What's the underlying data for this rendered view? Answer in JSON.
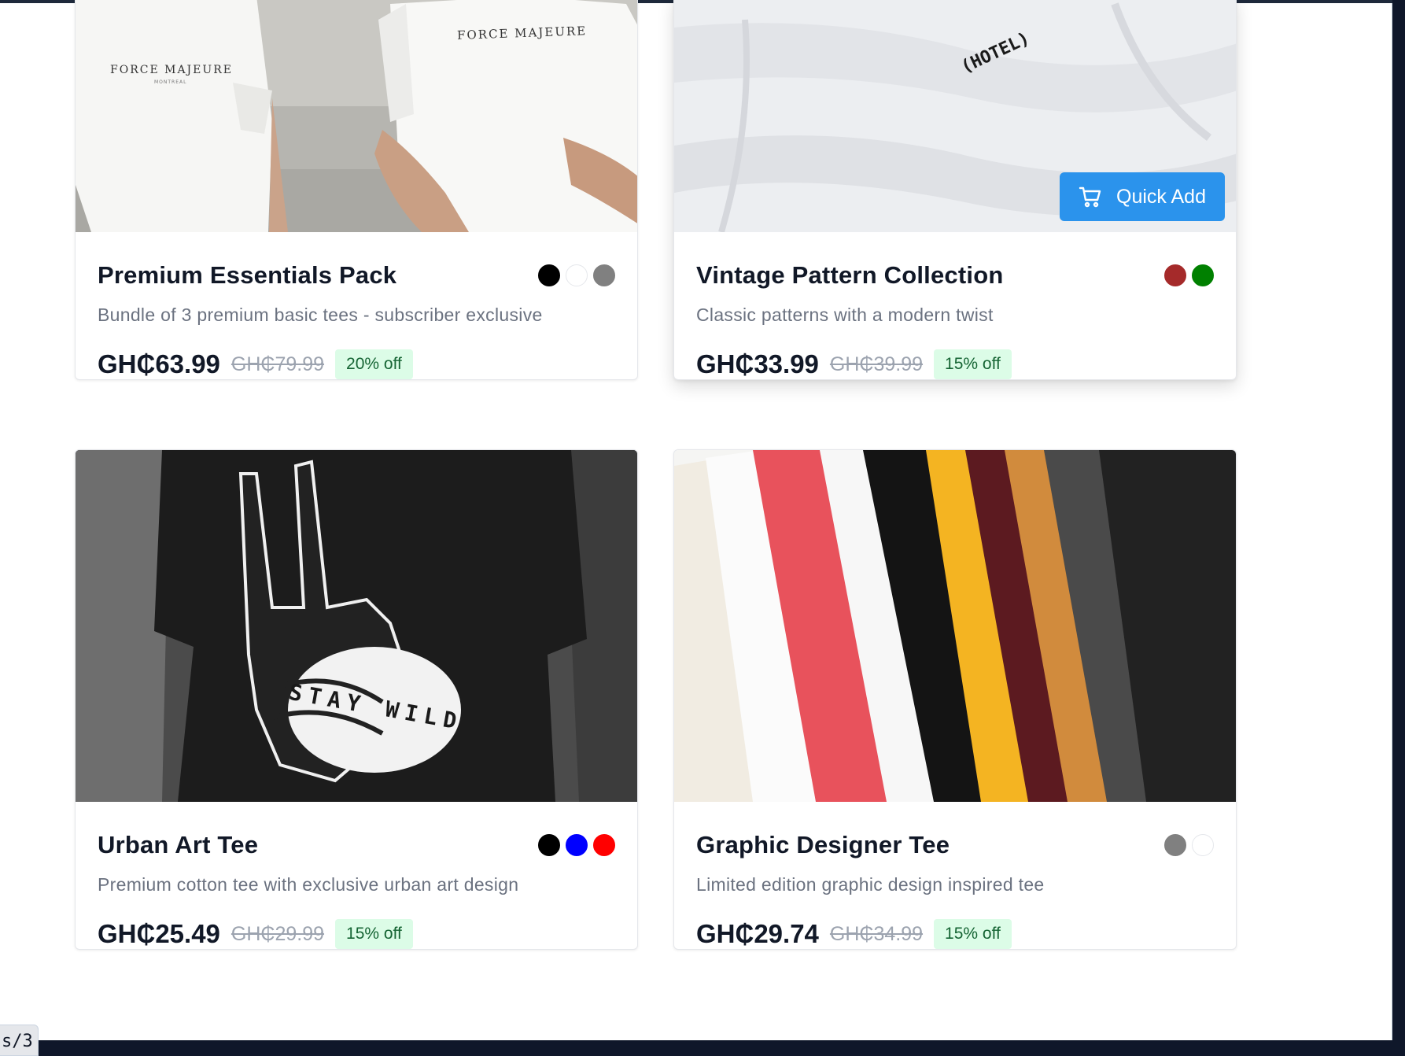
{
  "status_chip": {
    "text": "s/3"
  },
  "products": [
    {
      "name": "Premium Essentials Pack",
      "description": "Bundle of 3 premium basic tees - subscriber exclusive",
      "price": "GH₵63.99",
      "original_price": "GH₵79.99",
      "discount": "20% off",
      "colors": [
        "#000000",
        "#ffffff",
        "#808080"
      ],
      "image_text": [
        "FORCE MAJEURE",
        "FORCE MAJEURE",
        "MONTREAL"
      ]
    },
    {
      "name": "Vintage Pattern Collection",
      "description": "Classic patterns with a modern twist",
      "price": "GH₵33.99",
      "original_price": "GH₵39.99",
      "discount": "15% off",
      "colors": [
        "#a52a2a",
        "#008000"
      ],
      "image_text": [
        "(HOTEL)"
      ],
      "quick_add_label": "Quick Add",
      "quick_add_icon": "cart-icon"
    },
    {
      "name": "Urban Art Tee",
      "description": "Premium cotton tee with exclusive urban art design",
      "price": "GH₵25.49",
      "original_price": "GH₵29.99",
      "discount": "15% off",
      "colors": [
        "#000000",
        "#0000ff",
        "#ff0000"
      ],
      "image_text": [
        "STAY WILD"
      ]
    },
    {
      "name": "Graphic Designer Tee",
      "description": "Limited edition graphic design inspired tee",
      "price": "GH₵29.74",
      "original_price": "GH₵34.99",
      "discount": "15% off",
      "colors": [
        "#808080",
        "#ffffff"
      ]
    }
  ]
}
